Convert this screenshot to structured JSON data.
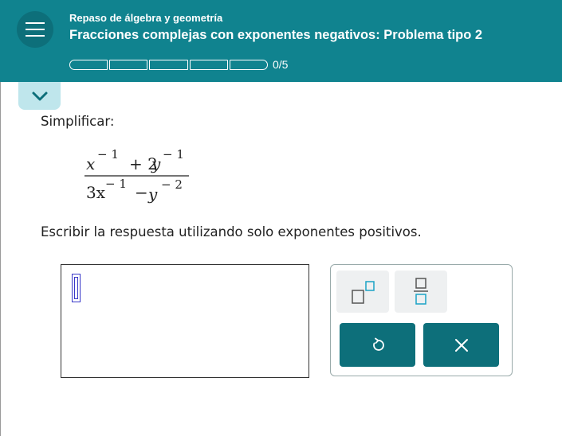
{
  "header": {
    "topic": "Repaso de álgebra y geometría",
    "title": "Fracciones complejas con exponentes negativos: Problema tipo 2",
    "progress_text": "0/5",
    "progress": {
      "completed": 0,
      "total": 5
    }
  },
  "problem": {
    "instruction": "Simplificar:",
    "expression": {
      "numerator": {
        "term1_base": "x",
        "term1_exp": "− 1",
        "op": "+ 2",
        "term2_base": "y",
        "term2_exp": "− 1"
      },
      "denominator": {
        "term1_base": "3x",
        "term1_exp": "− 1",
        "op": "−",
        "term2_base": "y",
        "term2_exp": "− 2"
      }
    },
    "instruction2": "Escribir la respuesta utilizando solo exponentes positivos."
  },
  "icons": {
    "menu": "hamburger-icon",
    "collapse": "chevron-down-icon",
    "superscript": "superscript-template-icon",
    "fraction": "fraction-template-icon",
    "undo": "undo-icon",
    "clear": "close-icon"
  },
  "colors": {
    "header_bg": "#10838f",
    "menu_bg": "#0d6f7a",
    "action_button": "#0d6f7a",
    "tool_accent": "#1aa3c6",
    "collapse_tab": "#bfe6ec"
  }
}
